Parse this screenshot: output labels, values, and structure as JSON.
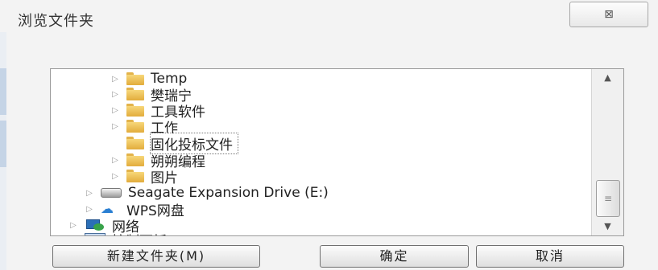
{
  "dialog": {
    "title": "浏览文件夹",
    "close_glyph": "⊠"
  },
  "tree": {
    "items": [
      {
        "label": "Temp",
        "icon": "folder-icon",
        "expander": "▷"
      },
      {
        "label": "樊瑞宁",
        "icon": "folder-icon",
        "expander": "▷"
      },
      {
        "label": "工具软件",
        "icon": "folder-icon",
        "expander": "▷"
      },
      {
        "label": "工作",
        "icon": "folder-icon",
        "expander": "▷"
      },
      {
        "label": "固化投标文件",
        "icon": "folder-icon",
        "expander": "",
        "selected": true
      },
      {
        "label": "朔朔编程",
        "icon": "folder-icon",
        "expander": "▷"
      },
      {
        "label": "图片",
        "icon": "folder-icon",
        "expander": "▷"
      },
      {
        "label": "Seagate Expansion Drive (E:)",
        "icon": "drive-icon",
        "expander": "▷"
      },
      {
        "label": "WPS网盘",
        "icon": "cloud-icon",
        "expander": "▷"
      },
      {
        "label": "网络",
        "icon": "network-icon",
        "expander": "▷"
      },
      {
        "label": "控制面板",
        "icon": "control-panel-icon",
        "expander": "▷"
      }
    ],
    "scroll": {
      "up": "▲",
      "down": "▼",
      "thumb": "≡"
    }
  },
  "buttons": {
    "new_folder": "新建文件夹(M)",
    "ok": "确定",
    "cancel": "取消"
  }
}
